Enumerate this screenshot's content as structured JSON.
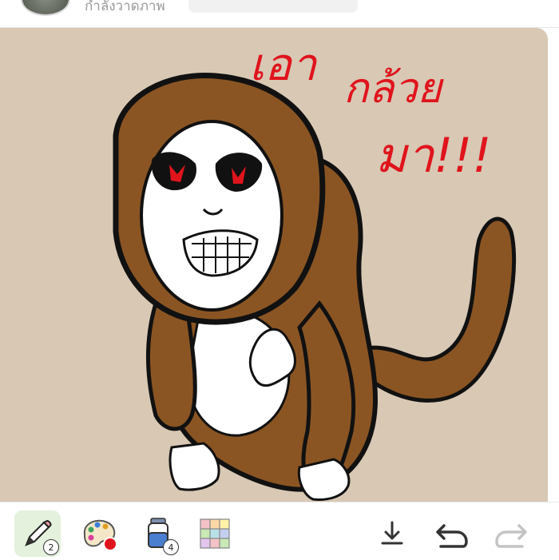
{
  "header": {
    "status_text": "กำลังวาดภาพ",
    "name_field_value": ""
  },
  "canvas": {
    "background_color": "#d8c8b4",
    "drawing_text_line1": "เอา",
    "drawing_text_line2": "กล้วย",
    "drawing_text_line3": "มา!!!",
    "ink_color": "#e0141c"
  },
  "toolbar": {
    "tools": [
      {
        "name": "pencil-icon",
        "badge": "2",
        "active": true
      },
      {
        "name": "palette-icon",
        "badge": "",
        "selected_color": "#e0141c"
      },
      {
        "name": "paint-bucket-icon",
        "badge": "4"
      },
      {
        "name": "grid-icon",
        "badge": ""
      }
    ],
    "actions": [
      {
        "name": "download-icon"
      },
      {
        "name": "undo-icon"
      },
      {
        "name": "redo-icon",
        "enabled": false
      }
    ]
  }
}
